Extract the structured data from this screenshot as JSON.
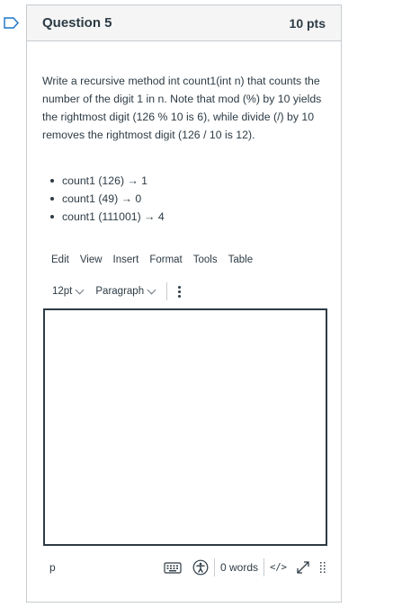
{
  "question": {
    "title": "Question 5",
    "points": "10 pts",
    "prompt": "Write a recursive method int count1(int n) that counts the number of the digit 1 in n. Note that mod (%) by 10 yields the rightmost digit (126 % 10 is 6), while divide (/) by 10 removes the rightmost digit (126 / 10 is 12).",
    "examples": [
      "count1 (126) → 1",
      "count1 (49) → 0",
      "count1 (111001) → 4"
    ]
  },
  "editor": {
    "menu": [
      "Edit",
      "View",
      "Insert",
      "Format",
      "Tools",
      "Table"
    ],
    "font_size": "12pt",
    "block_format": "Paragraph",
    "content": "",
    "path": "p",
    "word_count": "0 words",
    "html_toggle": "</>"
  },
  "icons": {
    "flag": "flag-icon",
    "more": "more-vertical-icon",
    "keyboard": "keyboard-icon",
    "accessibility": "accessibility-icon",
    "fullscreen": "fullscreen-icon",
    "resize": "resize-handle-icon"
  },
  "colors": {
    "text": "#2d3b45",
    "border": "#c7cdd1",
    "header_bg": "#f5f5f5",
    "flag": "#1a73c9"
  }
}
